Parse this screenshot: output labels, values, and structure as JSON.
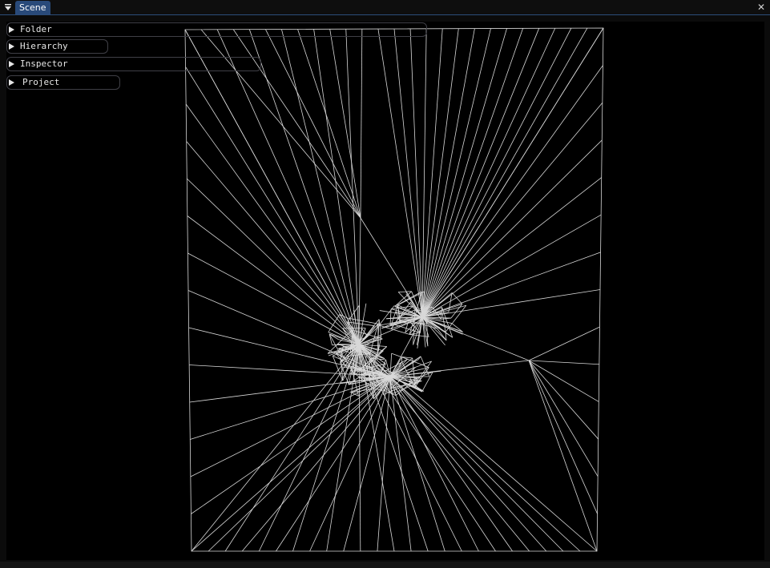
{
  "window": {
    "tab_label": "Scene",
    "close_glyph": "✕"
  },
  "panels": [
    {
      "label": "Folder"
    },
    {
      "label": "Hierarchy"
    },
    {
      "label": "Inspector"
    },
    {
      "label": "Project"
    }
  ],
  "icons": {
    "collapse": "triangle-down-icon",
    "close": "close-icon",
    "expand": "triangle-right-icon"
  },
  "colors": {
    "accent": "#294a7a",
    "mesh_stroke": "#d8d8d8",
    "background": "#000000"
  }
}
